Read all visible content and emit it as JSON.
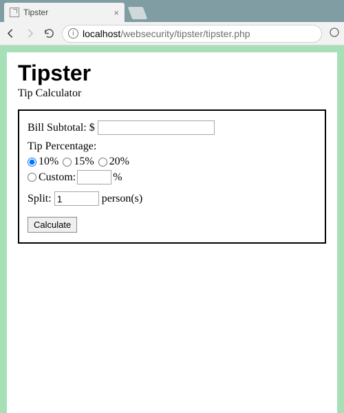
{
  "browser": {
    "tab_title": "Tipster",
    "url_host": "localhost",
    "url_path": "/websecurity/tipster/tipster.php"
  },
  "page": {
    "heading": "Tipster",
    "subtitle": "Tip Calculator"
  },
  "form": {
    "subtotal_label": "Bill Subtotal: $",
    "subtotal_value": "",
    "tip_label": "Tip Percentage:",
    "tips": {
      "opt10": "10%",
      "opt15": "15%",
      "opt20": "20%",
      "custom_label": "Custom:",
      "custom_value": "",
      "custom_suffix": "%",
      "selected": "10"
    },
    "split_label": "Split:",
    "split_value": "1",
    "split_suffix": "person(s)",
    "submit_label": "Calculate"
  }
}
